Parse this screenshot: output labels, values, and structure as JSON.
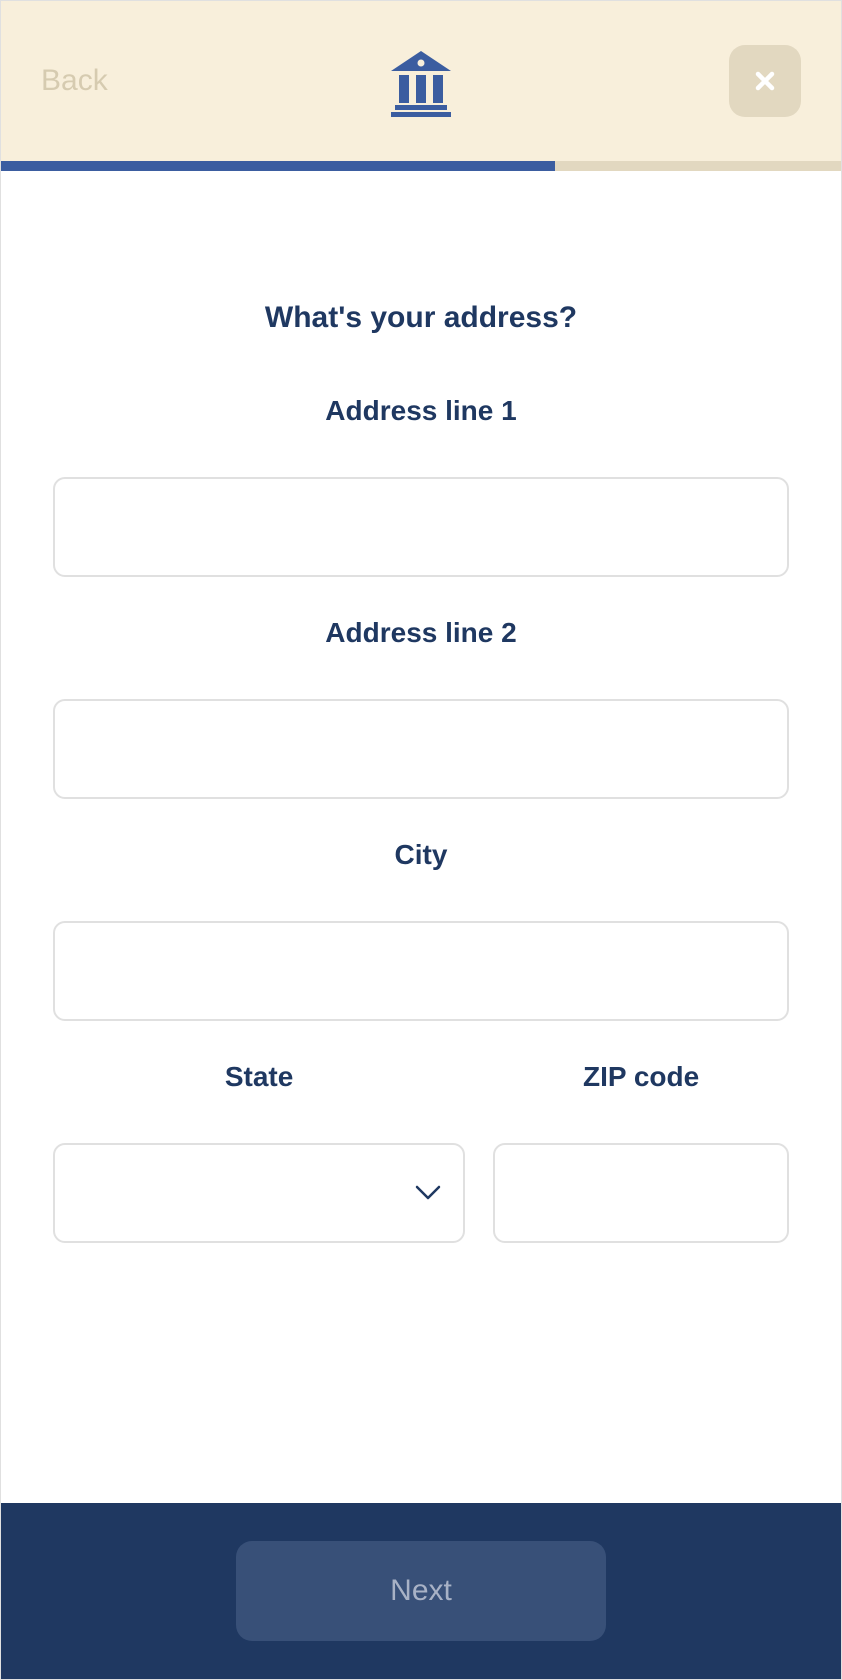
{
  "header": {
    "back_label": "Back",
    "close_icon": "close"
  },
  "progress": {
    "percent": 66
  },
  "form": {
    "title": "What's your address?",
    "fields": {
      "address1": {
        "label": "Address line 1",
        "value": ""
      },
      "address2": {
        "label": "Address line 2",
        "value": ""
      },
      "city": {
        "label": "City",
        "value": ""
      },
      "state": {
        "label": "State",
        "value": ""
      },
      "zip": {
        "label": "ZIP code",
        "value": ""
      }
    }
  },
  "footer": {
    "next_label": "Next"
  }
}
